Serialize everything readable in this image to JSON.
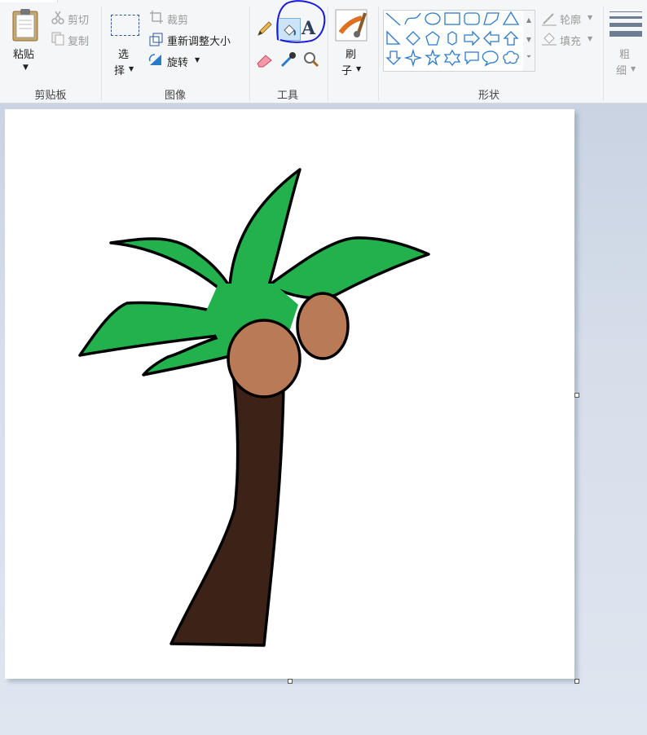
{
  "clipboard": {
    "paste_label": "粘贴",
    "cut_label": "剪切",
    "copy_label": "复制",
    "group_label": "剪贴板"
  },
  "image": {
    "select_label_1": "选",
    "select_label_2": "择",
    "crop_label": "裁剪",
    "resize_label": "重新调整大小",
    "rotate_label": "旋转",
    "group_label": "图像"
  },
  "tools": {
    "group_label": "工具",
    "items": [
      "pencil-icon",
      "fill-icon",
      "text-icon",
      "eraser-icon",
      "color-picker-icon",
      "magnifier-icon"
    ],
    "selected": "fill-icon"
  },
  "brushes": {
    "label_1": "刷",
    "label_2": "子"
  },
  "shapes": {
    "group_label": "形状",
    "outline_label": "轮廓",
    "fill_label": "填充",
    "items": [
      "line",
      "curve",
      "oval",
      "rectangle",
      "rounded-rectangle",
      "polygon",
      "triangle",
      "right-triangle",
      "diamond",
      "pentagon",
      "hexagon",
      "right-arrow",
      "left-arrow",
      "up-arrow",
      "down-arrow",
      "four-point-star",
      "five-point-star",
      "six-point-star",
      "rounded-callout",
      "oval-callout",
      "cloud-callout"
    ]
  },
  "size": {
    "label_1": "粗",
    "label_2": "细"
  },
  "colors": {
    "accent": "#2b579a",
    "annotation": "#1a1adb",
    "leaf": "#22b14c",
    "trunk": "#3d2317",
    "coconut": "#b97a57",
    "outline": "#000000"
  }
}
